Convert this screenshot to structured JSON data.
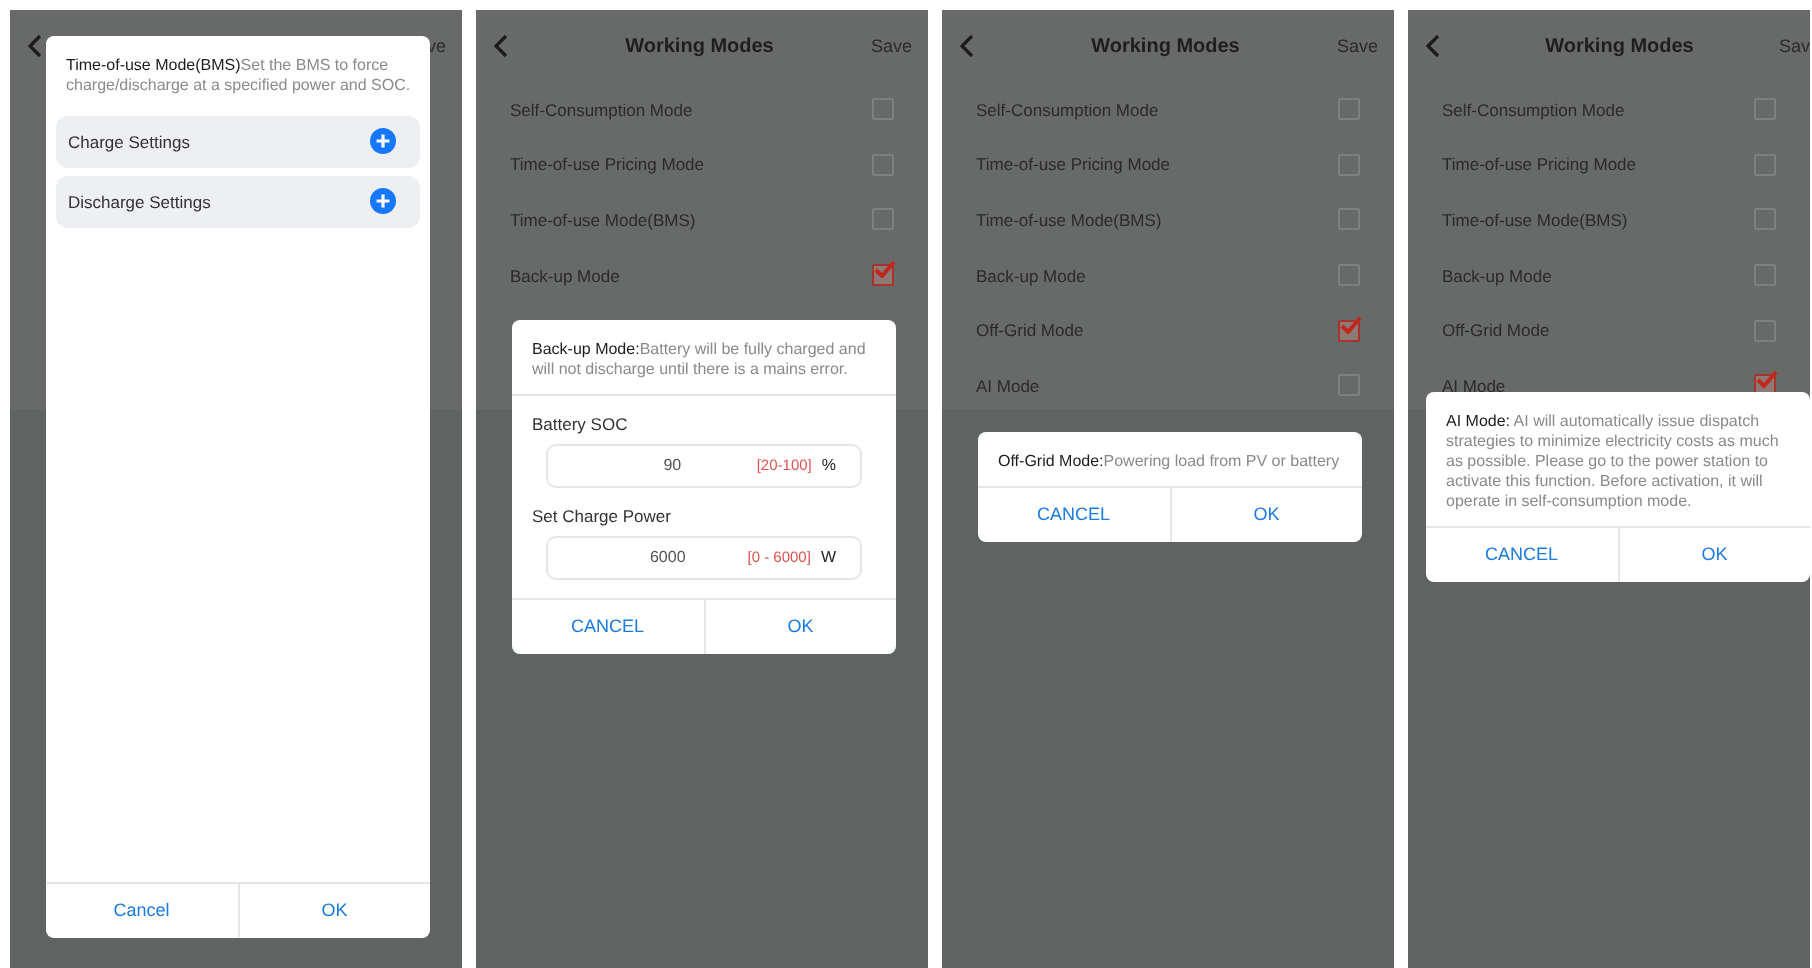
{
  "screens": [
    {
      "header": {
        "action": "ve"
      },
      "dialog": {
        "kind": "settings",
        "text": "**Time-of-use Mode(BMS)**Set the BMS to force charge/discharge at a specified power and SOC.",
        "items": [
          {
            "label": "Charge Settings"
          },
          {
            "label": "Discharge Settings"
          }
        ],
        "buttons": [
          "Cancel",
          "OK"
        ]
      }
    },
    {
      "header": {
        "title": "Working Modes",
        "action": "Save"
      },
      "rows": [
        {
          "label": "Self-Consumption Mode",
          "checked": false
        },
        {
          "label": "Time-of-use Pricing Mode",
          "checked": false
        },
        {
          "label": "Time-of-use Mode(BMS)",
          "checked": false
        },
        {
          "label": "Back-up Mode",
          "checked": true
        }
      ],
      "dialog": {
        "kind": "form",
        "text": "**Back-up Mode:**Battery will be fully charged and will not discharge until there is a mains error.",
        "fields": [
          {
            "label": "Battery SOC",
            "value": "90",
            "range": "[20-100]",
            "unit": "%"
          },
          {
            "label": "Set Charge Power",
            "value": "6000",
            "range": "[0 - 6000]",
            "unit": "W"
          }
        ],
        "buttons": [
          "CANCEL",
          "OK"
        ]
      }
    },
    {
      "header": {
        "title": "Working Modes",
        "action": "Save"
      },
      "rows": [
        {
          "label": "Self-Consumption Mode",
          "checked": false
        },
        {
          "label": "Time-of-use Pricing Mode",
          "checked": false
        },
        {
          "label": "Time-of-use Mode(BMS)",
          "checked": false
        },
        {
          "label": "Back-up Mode",
          "checked": false
        },
        {
          "label": "Off-Grid Mode",
          "checked": true
        },
        {
          "label": "AI Mode",
          "checked": false
        }
      ],
      "dialog": {
        "kind": "message",
        "text": "**Off-Grid Mode:**Powering load from PV or battery",
        "buttons": [
          "CANCEL",
          "OK"
        ]
      }
    },
    {
      "header": {
        "title": "Working Modes",
        "action": "Sav"
      },
      "rows": [
        {
          "label": "Self-Consumption Mode",
          "checked": false
        },
        {
          "label": "Time-of-use Pricing Mode",
          "checked": false
        },
        {
          "label": "Time-of-use Mode(BMS)",
          "checked": false
        },
        {
          "label": "Back-up Mode",
          "checked": false
        },
        {
          "label": "Off-Grid Mode",
          "checked": false
        },
        {
          "label": "AI Mode",
          "checked": true
        }
      ],
      "dialog": {
        "kind": "message",
        "text": "**AI Mode:** AI will automatically issue dispatch strategies to minimize electricity costs as much as possible. Please go to the power station to activate this function. Before activation, it will operate in self-consumption mode.",
        "buttons": [
          "CANCEL",
          "OK"
        ]
      }
    }
  ]
}
